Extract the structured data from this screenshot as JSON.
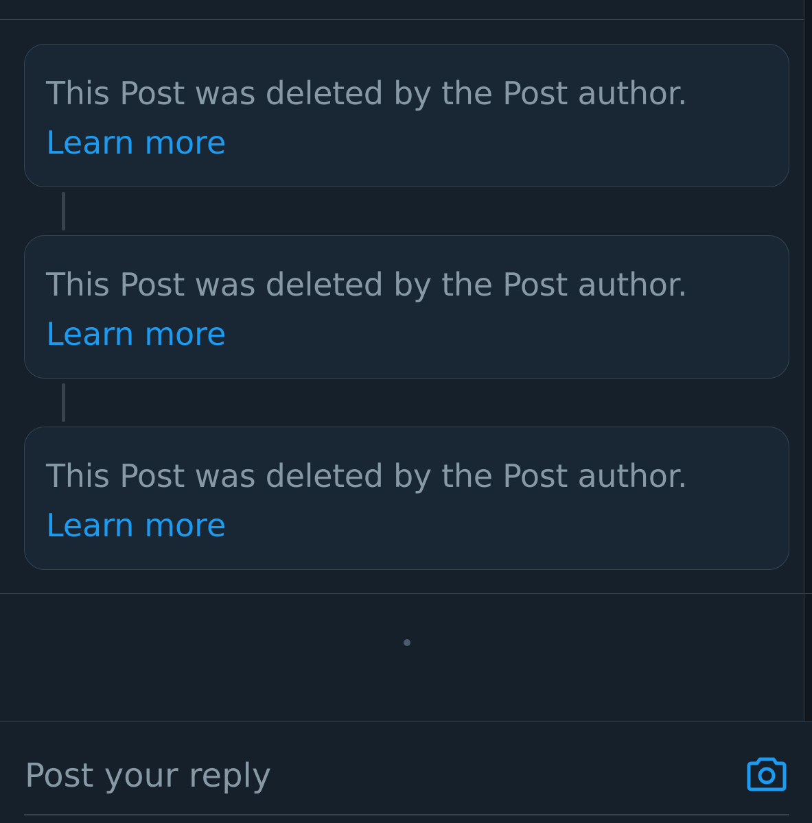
{
  "thread": {
    "tombstones": [
      {
        "message": "This Post was deleted by the Post author.",
        "link": "Learn more"
      },
      {
        "message": "This Post was deleted by the Post author.",
        "link": "Learn more"
      },
      {
        "message": "This Post was deleted by the Post author.",
        "link": "Learn more"
      }
    ]
  },
  "reply": {
    "placeholder": "Post your reply",
    "camera_icon": "camera-icon"
  },
  "colors": {
    "background": "#15202b",
    "card": "#192734",
    "border": "#38444d",
    "secondary_text": "#8899a6",
    "accent": "#1d9bf0"
  }
}
